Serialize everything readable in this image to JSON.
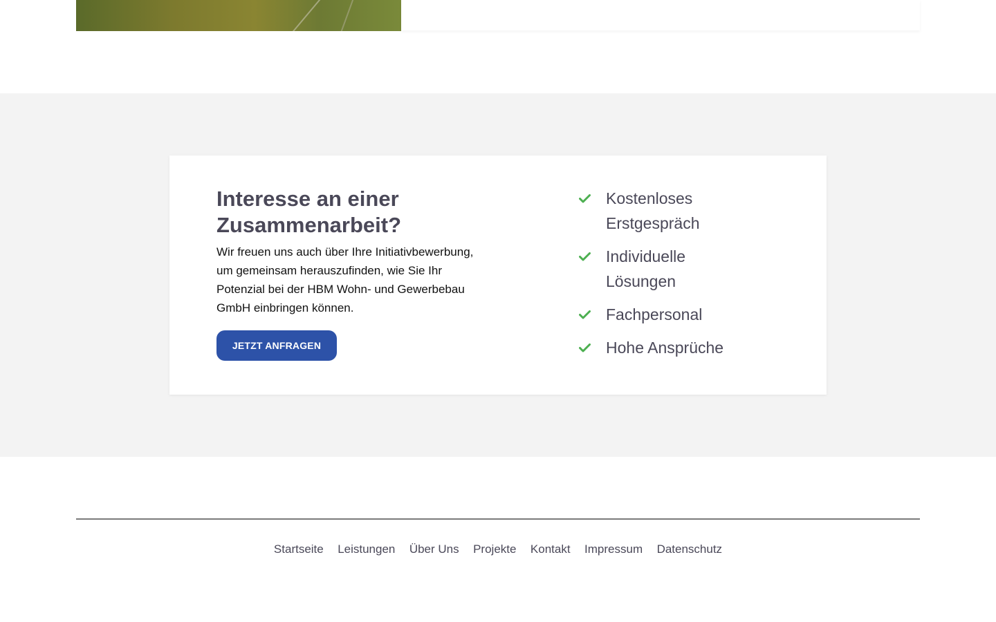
{
  "cta": {
    "title": "Interesse an einer Zusammenarbeit?",
    "text": "Wir freuen uns auch über Ihre Initiativbewerbung, um gemeinsam herauszufinden, wie Sie Ihr Potenzial bei der HBM Wohn- und Gewerbebau GmbH einbringen können.",
    "button_label": "JETZT ANFRAGEN",
    "features": [
      {
        "label": "Kostenloses Erstgespräch",
        "icon": "check-icon"
      },
      {
        "label": "Individuelle Lösungen",
        "icon": "check-icon"
      },
      {
        "label": "Fachpersonal",
        "icon": "check-icon"
      },
      {
        "label": "Hohe Ansprüche",
        "icon": "check-icon"
      }
    ]
  },
  "footer": {
    "links": [
      "Startseite",
      "Leistungen",
      "Über Uns",
      "Projekte",
      "Kontakt",
      "Impressum",
      "Datenschutz"
    ]
  },
  "colors": {
    "accent": "#2d52a8",
    "check": "#4caf50",
    "heading": "#4a4858",
    "section_bg": "#f3f3f3"
  }
}
